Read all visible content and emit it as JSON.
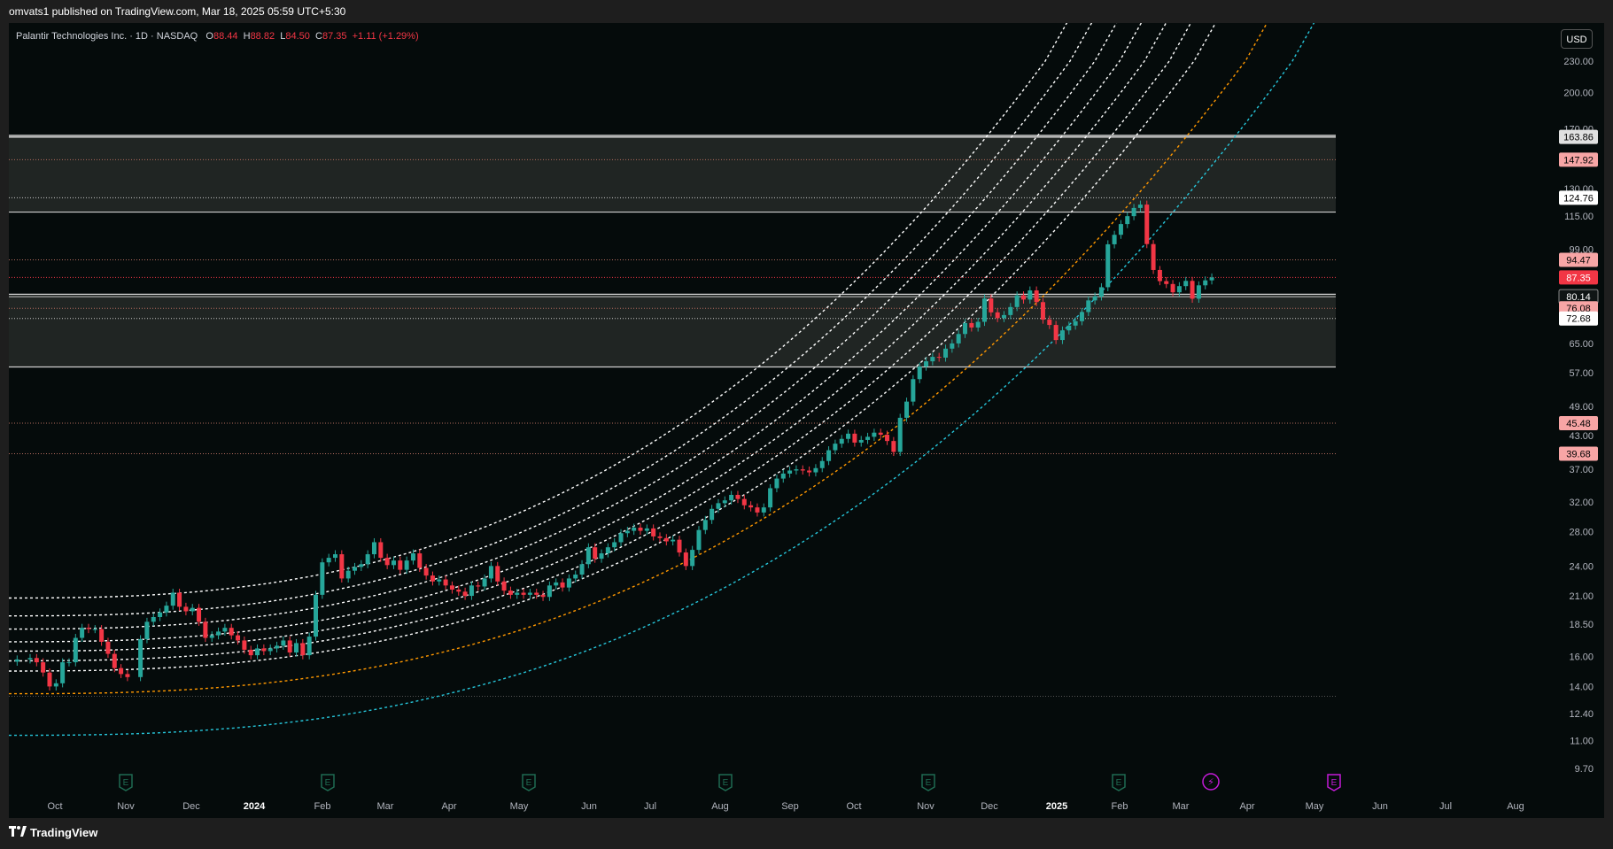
{
  "header": {
    "published_by": "omvats1 published on TradingView.com, Mar 18, 2025 05:59 UTC+5:30"
  },
  "legend": {
    "symbol": "Palantir Technologies Inc. · 1D · NASDAQ",
    "o_label": "O",
    "o_value": "88.44",
    "h_label": "H",
    "h_value": "88.82",
    "l_label": "L",
    "l_value": "84.50",
    "c_label": "C",
    "c_value": "87.35",
    "change": "+1.11 (+1.29%)"
  },
  "currency_button": "USD",
  "footer": {
    "brand": "TradingView"
  },
  "colors": {
    "background": "#050b0b",
    "up": "#26a69a",
    "down": "#f23645",
    "channel_white": "#ffffff",
    "channel_orange": "#ff9800",
    "channel_blue": "#26c6da",
    "earnings_badge": "#1f6b52",
    "earnings_upcoming": "#c41bd8"
  },
  "chart_data": {
    "type": "candlestick",
    "symbol": "PLTR",
    "timeframe": "1D",
    "y_scale": "log",
    "y_tick_labels": [
      "230.00",
      "200.00",
      "170.00",
      "130.00",
      "115.00",
      "99.00",
      "65.00",
      "57.00",
      "49.00",
      "43.00",
      "37.00",
      "32.00",
      "28.00",
      "24.00",
      "21.00",
      "18.50",
      "16.00",
      "14.00",
      "12.40",
      "11.00",
      "9.70"
    ],
    "x_tick_labels": [
      "Oct",
      "Nov",
      "Dec",
      "2024",
      "Feb",
      "Mar",
      "Apr",
      "May",
      "Jun",
      "Jul",
      "Aug",
      "Sep",
      "Oct",
      "Nov",
      "Dec",
      "2025",
      "Feb",
      "Mar",
      "Apr",
      "May",
      "Jun",
      "Jul",
      "Aug"
    ],
    "x_tick_bold": [
      "2024",
      "2025"
    ],
    "price_badges": [
      {
        "label": "163.86",
        "style": "light"
      },
      {
        "label": "147.92",
        "style": "pink"
      },
      {
        "label": "124.76",
        "style": "white"
      },
      {
        "label": "94.47",
        "style": "pink"
      },
      {
        "label": "87.35",
        "style": "red"
      },
      {
        "label": "80.14",
        "style": "dark"
      },
      {
        "label": "76.08",
        "style": "pink"
      },
      {
        "label": "72.68",
        "style": "white"
      },
      {
        "label": "45.48",
        "style": "pink"
      },
      {
        "label": "39.68",
        "style": "pink"
      }
    ],
    "zones": [
      {
        "from": 117,
        "to": 165
      },
      {
        "from": 58.5,
        "to": 81
      }
    ],
    "candles": [
      [
        1,
        15.8
      ],
      [
        3,
        15.9
      ],
      [
        4,
        15.6
      ],
      [
        5,
        14.9
      ],
      [
        6,
        14.0
      ],
      [
        7,
        14.2
      ],
      [
        8,
        15.6
      ],
      [
        9,
        15.6
      ],
      [
        10,
        17.4
      ],
      [
        11,
        18.2
      ],
      [
        12,
        18.1
      ],
      [
        13,
        18.1
      ],
      [
        14,
        17.1
      ],
      [
        15,
        16.2
      ],
      [
        16,
        15.2
      ],
      [
        17,
        14.8
      ],
      [
        18,
        14.6
      ],
      [
        20,
        17.3
      ],
      [
        21,
        18.7
      ],
      [
        22,
        19.1
      ],
      [
        23,
        19.5
      ],
      [
        24,
        20.1
      ],
      [
        25,
        21.3
      ],
      [
        26,
        20.0
      ],
      [
        27,
        19.6
      ],
      [
        28,
        19.9
      ],
      [
        29,
        18.7
      ],
      [
        30,
        17.4
      ],
      [
        31,
        17.6
      ],
      [
        32,
        17.9
      ],
      [
        33,
        18.2
      ],
      [
        34,
        17.6
      ],
      [
        35,
        17.2
      ],
      [
        36,
        16.5
      ],
      [
        37,
        16.1
      ],
      [
        38,
        16.6
      ],
      [
        39,
        16.4
      ],
      [
        40,
        16.6
      ],
      [
        41,
        16.8
      ],
      [
        42,
        17.2
      ],
      [
        43,
        16.3
      ],
      [
        44,
        17.0
      ],
      [
        45,
        16.1
      ],
      [
        46,
        17.5
      ],
      [
        47,
        21.1
      ],
      [
        48,
        24.4
      ],
      [
        49,
        24.9
      ],
      [
        50,
        25.3
      ],
      [
        51,
        22.7
      ],
      [
        52,
        23.5
      ],
      [
        53,
        23.9
      ],
      [
        54,
        24.2
      ],
      [
        55,
        25.3
      ],
      [
        56,
        26.7
      ],
      [
        57,
        24.9
      ],
      [
        58,
        24.1
      ],
      [
        59,
        24.6
      ],
      [
        60,
        23.6
      ],
      [
        61,
        24.6
      ],
      [
        62,
        25.4
      ],
      [
        63,
        23.8
      ],
      [
        64,
        23.0
      ],
      [
        65,
        22.4
      ],
      [
        66,
        22.6
      ],
      [
        67,
        22.0
      ],
      [
        68,
        21.6
      ],
      [
        69,
        21.4
      ],
      [
        70,
        21.0
      ],
      [
        71,
        22.0
      ],
      [
        72,
        21.9
      ],
      [
        73,
        22.7
      ],
      [
        74,
        24.0
      ],
      [
        75,
        22.4
      ],
      [
        76,
        21.5
      ],
      [
        77,
        21.1
      ],
      [
        78,
        21.3
      ],
      [
        79,
        21.1
      ],
      [
        80,
        21.3
      ],
      [
        81,
        21.1
      ],
      [
        82,
        20.9
      ],
      [
        83,
        22.0
      ],
      [
        84,
        22.3
      ],
      [
        85,
        21.8
      ],
      [
        86,
        22.7
      ],
      [
        87,
        23.1
      ],
      [
        88,
        24.2
      ],
      [
        89,
        26.1
      ],
      [
        90,
        24.8
      ],
      [
        91,
        25.4
      ],
      [
        92,
        26.1
      ],
      [
        93,
        26.7
      ],
      [
        94,
        27.8
      ],
      [
        95,
        28.1
      ],
      [
        96,
        28.5
      ],
      [
        97,
        28.1
      ],
      [
        98,
        28.4
      ],
      [
        99,
        27.4
      ],
      [
        100,
        27.2
      ],
      [
        101,
        26.8
      ],
      [
        102,
        27.0
      ],
      [
        103,
        25.5
      ],
      [
        104,
        24.0
      ],
      [
        105,
        25.8
      ],
      [
        106,
        28.2
      ],
      [
        107,
        29.5
      ],
      [
        108,
        31.0
      ],
      [
        109,
        31.8
      ],
      [
        110,
        32.2
      ],
      [
        111,
        33.0
      ],
      [
        112,
        32.4
      ],
      [
        113,
        31.5
      ],
      [
        114,
        31.2
      ],
      [
        115,
        30.5
      ],
      [
        116,
        31.2
      ],
      [
        117,
        34.0
      ],
      [
        118,
        35.5
      ],
      [
        119,
        36.3
      ],
      [
        120,
        36.8
      ],
      [
        121,
        37.0
      ],
      [
        122,
        36.8
      ],
      [
        123,
        36.5
      ],
      [
        124,
        37.2
      ],
      [
        125,
        38.4
      ],
      [
        126,
        40.3
      ],
      [
        127,
        41.5
      ],
      [
        128,
        42.4
      ],
      [
        129,
        43.4
      ],
      [
        130,
        41.7
      ],
      [
        131,
        42.2
      ],
      [
        132,
        42.8
      ],
      [
        133,
        43.6
      ],
      [
        134,
        43.2
      ],
      [
        135,
        42.0
      ],
      [
        136,
        40.0
      ],
      [
        137,
        46.6
      ],
      [
        138,
        50.1
      ],
      [
        139,
        55.4
      ],
      [
        140,
        58.6
      ],
      [
        141,
        60.0
      ],
      [
        142,
        61.2
      ],
      [
        143,
        61.0
      ],
      [
        144,
        63.5
      ],
      [
        145,
        65.0
      ],
      [
        146,
        67.8
      ],
      [
        147,
        71.2
      ],
      [
        148,
        69.8
      ],
      [
        149,
        71.6
      ],
      [
        150,
        79.5
      ],
      [
        151,
        74.7
      ],
      [
        152,
        72.8
      ],
      [
        153,
        73.8
      ],
      [
        154,
        76.5
      ],
      [
        155,
        80.6
      ],
      [
        156,
        79.1
      ],
      [
        157,
        82.4
      ],
      [
        158,
        78.2
      ],
      [
        159,
        72.3
      ],
      [
        160,
        70.6
      ],
      [
        161,
        66.0
      ],
      [
        162,
        68.9
      ],
      [
        163,
        70.4
      ],
      [
        164,
        71.8
      ],
      [
        165,
        74.8
      ],
      [
        166,
        78.8
      ],
      [
        167,
        80.2
      ],
      [
        168,
        83.6
      ],
      [
        169,
        101.3
      ],
      [
        170,
        105.7
      ],
      [
        171,
        110.9
      ],
      [
        172,
        114.9
      ],
      [
        173,
        119.2
      ],
      [
        174,
        121.0
      ],
      [
        175,
        101.4
      ],
      [
        176,
        90.3
      ],
      [
        177,
        85.9
      ],
      [
        178,
        84.8
      ],
      [
        179,
        81.7
      ],
      [
        180,
        84.0
      ],
      [
        181,
        86.0
      ],
      [
        182,
        79.4
      ],
      [
        183,
        84.3
      ],
      [
        184,
        86.2
      ],
      [
        185,
        87.35
      ]
    ],
    "channels": [
      {
        "color": "white",
        "start_price": 20.8,
        "end_price": 230
      },
      {
        "color": "white",
        "start_price": 19.2,
        "end_price": 230
      },
      {
        "color": "white",
        "start_price": 18.1,
        "end_price": 230
      },
      {
        "color": "white",
        "start_price": 17.1,
        "end_price": 230
      },
      {
        "color": "white",
        "start_price": 16.4,
        "end_price": 230
      },
      {
        "color": "white",
        "start_price": 15.7,
        "end_price": 230
      },
      {
        "color": "white",
        "start_price": 15.0,
        "end_price": 230
      },
      {
        "color": "orange",
        "start_price": 13.55,
        "end_price": 230
      },
      {
        "color": "blue",
        "start_price": 11.25,
        "end_price": 230
      }
    ],
    "earnings_events": [
      {
        "label": "E",
        "x_month": "Nov 2023"
      },
      {
        "label": "E",
        "x_month": "Feb 2024"
      },
      {
        "label": "E",
        "x_month": "May 2024"
      },
      {
        "label": "E",
        "x_month": "Aug 2024"
      },
      {
        "label": "E",
        "x_month": "Nov 2024"
      },
      {
        "label": "E",
        "x_month": "Feb 2025"
      },
      {
        "label": "⚡",
        "x_month": "Mar 2025"
      },
      {
        "label": "E",
        "x_month": "May 2025",
        "upcoming": true
      }
    ]
  }
}
